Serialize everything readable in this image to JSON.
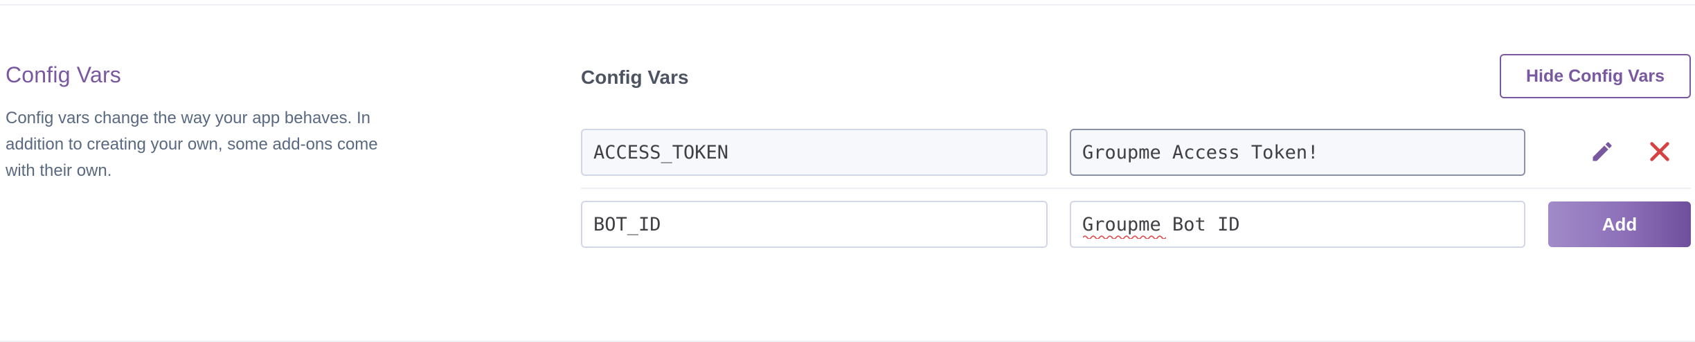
{
  "section": {
    "title": "Config Vars",
    "description": "Config vars change the way your app behaves. In addition to creating your own, some add-ons come with their own."
  },
  "panel": {
    "title": "Config Vars",
    "hide_button_label": "Hide Config Vars"
  },
  "rows": [
    {
      "key": "ACCESS_TOKEN",
      "value": "Groupme Access Token!",
      "actions": [
        "pencil-icon",
        "close-icon"
      ]
    }
  ],
  "new_row": {
    "key": "BOT_ID",
    "value": "Groupme Bot ID",
    "add_label": "Add"
  },
  "colors": {
    "accent": "#79589f",
    "delete": "#d64242",
    "edit": "#79589f"
  }
}
